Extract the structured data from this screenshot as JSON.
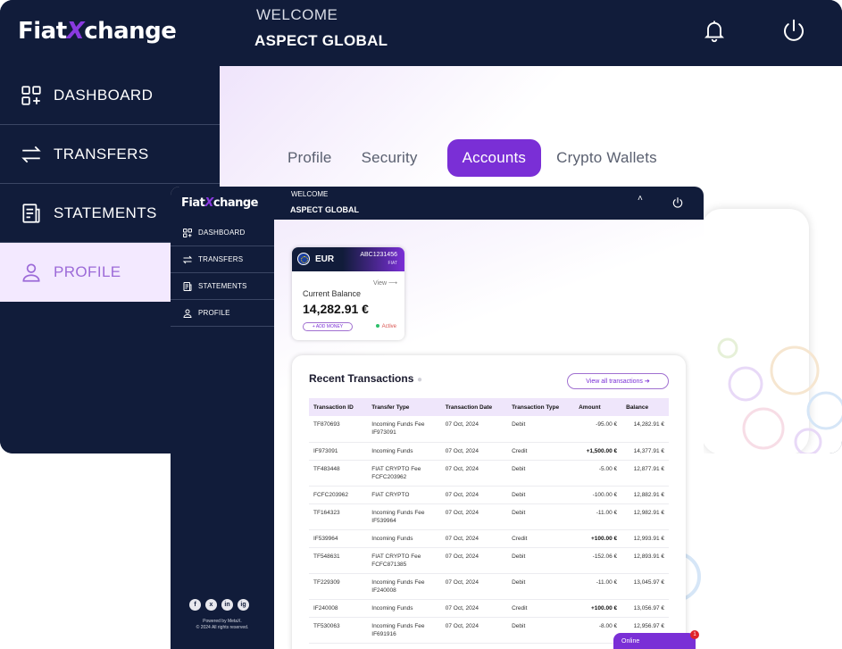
{
  "back": {
    "logo": {
      "pre": "Fiat",
      "x": "X",
      "post": "change"
    },
    "welcome": "WELCOME",
    "company": "ASPECT GLOBAL",
    "sidebar": [
      {
        "label": "DASHBOARD",
        "icon": "dashboard-icon"
      },
      {
        "label": "TRANSFERS",
        "icon": "transfers-icon"
      },
      {
        "label": "STATEMENTS",
        "icon": "statements-icon"
      },
      {
        "label": "PROFILE",
        "icon": "profile-icon",
        "active": true
      }
    ],
    "tabs": [
      "Profile",
      "Security",
      "Accounts",
      "Crypto Wallets"
    ],
    "active_tab": "Accounts"
  },
  "front": {
    "logo": {
      "pre": "Fiat",
      "x": "X",
      "post": "change"
    },
    "welcome": "WELCOME",
    "company": "ASPECT GLOBAL",
    "caret": "˄",
    "sidebar": [
      {
        "label": "DASHBOARD"
      },
      {
        "label": "TRANSFERS"
      },
      {
        "label": "STATEMENTS"
      },
      {
        "label": "PROFILE"
      }
    ],
    "social": [
      "f",
      "x",
      "in",
      "ig"
    ],
    "powered_line1": "Powered by MetaX.",
    "powered_line2": "© 2024 All rights reserved.",
    "account": {
      "currency": "EUR",
      "number": "ABC1231456",
      "type": "FIAT",
      "view": "View ⟶",
      "balance_label": "Current Balance",
      "balance": "14,282.91 €",
      "add_money": "+ ADD MONEY",
      "status": "Active"
    },
    "transactions": {
      "title": "Recent Transactions",
      "view_all": "View all transactions ➔",
      "headers": [
        "Transaction ID",
        "Transfer Type",
        "Transaction Date",
        "Transaction Type",
        "Amount",
        "Balance"
      ],
      "rows": [
        {
          "id": "TF870693",
          "type1": "Incoming Funds Fee",
          "type2": "IF973091",
          "date": "07 Oct, 2024",
          "kind": "Debit",
          "amount": "-95.00 €",
          "balance": "14,282.91 €"
        },
        {
          "id": "IF973091",
          "type1": "Incoming Funds",
          "type2": "",
          "date": "07 Oct, 2024",
          "kind": "Credit",
          "amount": "+1,500.00 €",
          "balance": "14,377.91 €"
        },
        {
          "id": "TF483448",
          "type1": "FIAT CRYPTO Fee",
          "type2": "FCFC203962",
          "date": "07 Oct, 2024",
          "kind": "Debit",
          "amount": "-5.00 €",
          "balance": "12,877.91 €"
        },
        {
          "id": "FCFC203962",
          "type1": "FIAT CRYPTO",
          "type2": "",
          "date": "07 Oct, 2024",
          "kind": "Debit",
          "amount": "-100.00 €",
          "balance": "12,882.91 €"
        },
        {
          "id": "TF164323",
          "type1": "Incoming Funds Fee",
          "type2": "IF539964",
          "date": "07 Oct, 2024",
          "kind": "Debit",
          "amount": "-11.00 €",
          "balance": "12,982.91 €"
        },
        {
          "id": "IF539964",
          "type1": "Incoming Funds",
          "type2": "",
          "date": "07 Oct, 2024",
          "kind": "Credit",
          "amount": "+100.00 €",
          "balance": "12,993.91 €"
        },
        {
          "id": "TF548631",
          "type1": "FIAT CRYPTO Fee",
          "type2": "FCFC871385",
          "date": "07 Oct, 2024",
          "kind": "Debit",
          "amount": "-152.06 €",
          "balance": "12,893.91 €"
        },
        {
          "id": "TF229309",
          "type1": "Incoming Funds Fee",
          "type2": "IF240008",
          "date": "07 Oct, 2024",
          "kind": "Debit",
          "amount": "-11.00 €",
          "balance": "13,045.97 €"
        },
        {
          "id": "IF240008",
          "type1": "Incoming Funds",
          "type2": "",
          "date": "07 Oct, 2024",
          "kind": "Credit",
          "amount": "+100.00 €",
          "balance": "13,056.97 €"
        },
        {
          "id": "TF530063",
          "type1": "Incoming Funds Fee",
          "type2": "IF691916",
          "date": "07 Oct, 2024",
          "kind": "Debit",
          "amount": "-8.00 €",
          "balance": "12,956.97 €"
        }
      ]
    },
    "chat": {
      "label": "Online",
      "badge": "1"
    }
  },
  "colors": {
    "navy": "#111c3a",
    "accent": "#7a2fd6",
    "profile_active_bg": "#f3e9ff"
  }
}
